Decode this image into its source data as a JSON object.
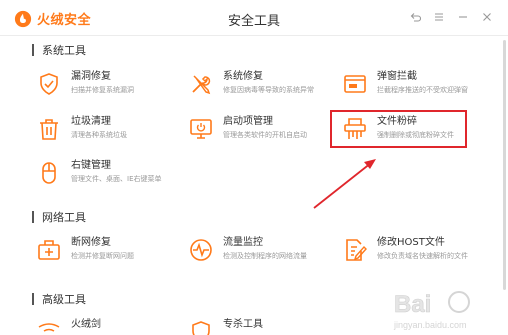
{
  "app": {
    "logo_text": "火绒安全",
    "window_title": "安全工具"
  },
  "window_controls": [
    {
      "icon": "back-icon"
    },
    {
      "icon": "menu-icon"
    },
    {
      "icon": "minimize-icon"
    },
    {
      "icon": "close-icon"
    }
  ],
  "sections": [
    {
      "title": "系统工具"
    },
    {
      "title": "网络工具"
    },
    {
      "title": "高级工具"
    }
  ],
  "tools": [
    {
      "name": "漏洞修复",
      "desc": "扫描并修复系统漏洞",
      "icon": "shield-icon"
    },
    {
      "name": "系统修复",
      "desc": "修复因病毒等导致的系统异常",
      "icon": "wrench-screwdriver-icon"
    },
    {
      "name": "弹窗拦截",
      "desc": "拦截程序推送的不受欢迎弹窗",
      "icon": "popup-window-icon"
    },
    {
      "name": "垃圾清理",
      "desc": "清理各种系统垃圾",
      "icon": "trash-icon"
    },
    {
      "name": "启动项管理",
      "desc": "管理各类软件的开机自启动",
      "icon": "monitor-power-icon"
    },
    {
      "name": "文件粉碎",
      "desc": "强制删除或彻底粉碎文件",
      "icon": "shredder-icon"
    },
    {
      "name": "右键管理",
      "desc": "管理文件、桌面、IE右键菜单",
      "icon": "mouse-icon"
    },
    {
      "name": "断网修复",
      "desc": "检测并修复断网问题",
      "icon": "network-plus-icon"
    },
    {
      "name": "流量监控",
      "desc": "检测及控制程序的网络流量",
      "icon": "traffic-gauge-icon"
    },
    {
      "name": "修改HOST文件",
      "desc": "修改负责域名快速解析的文件",
      "icon": "edit-document-icon"
    },
    {
      "name": "火绒剑",
      "desc": "",
      "icon": "sword-icon"
    },
    {
      "name": "专杀工具",
      "desc": "",
      "icon": "shield-icon"
    }
  ],
  "watermark": {
    "text": "Bai",
    "sub": "jingyan.baidu.com"
  },
  "colors": {
    "accent": "#ff7a1a",
    "highlight": "#e0262c"
  }
}
